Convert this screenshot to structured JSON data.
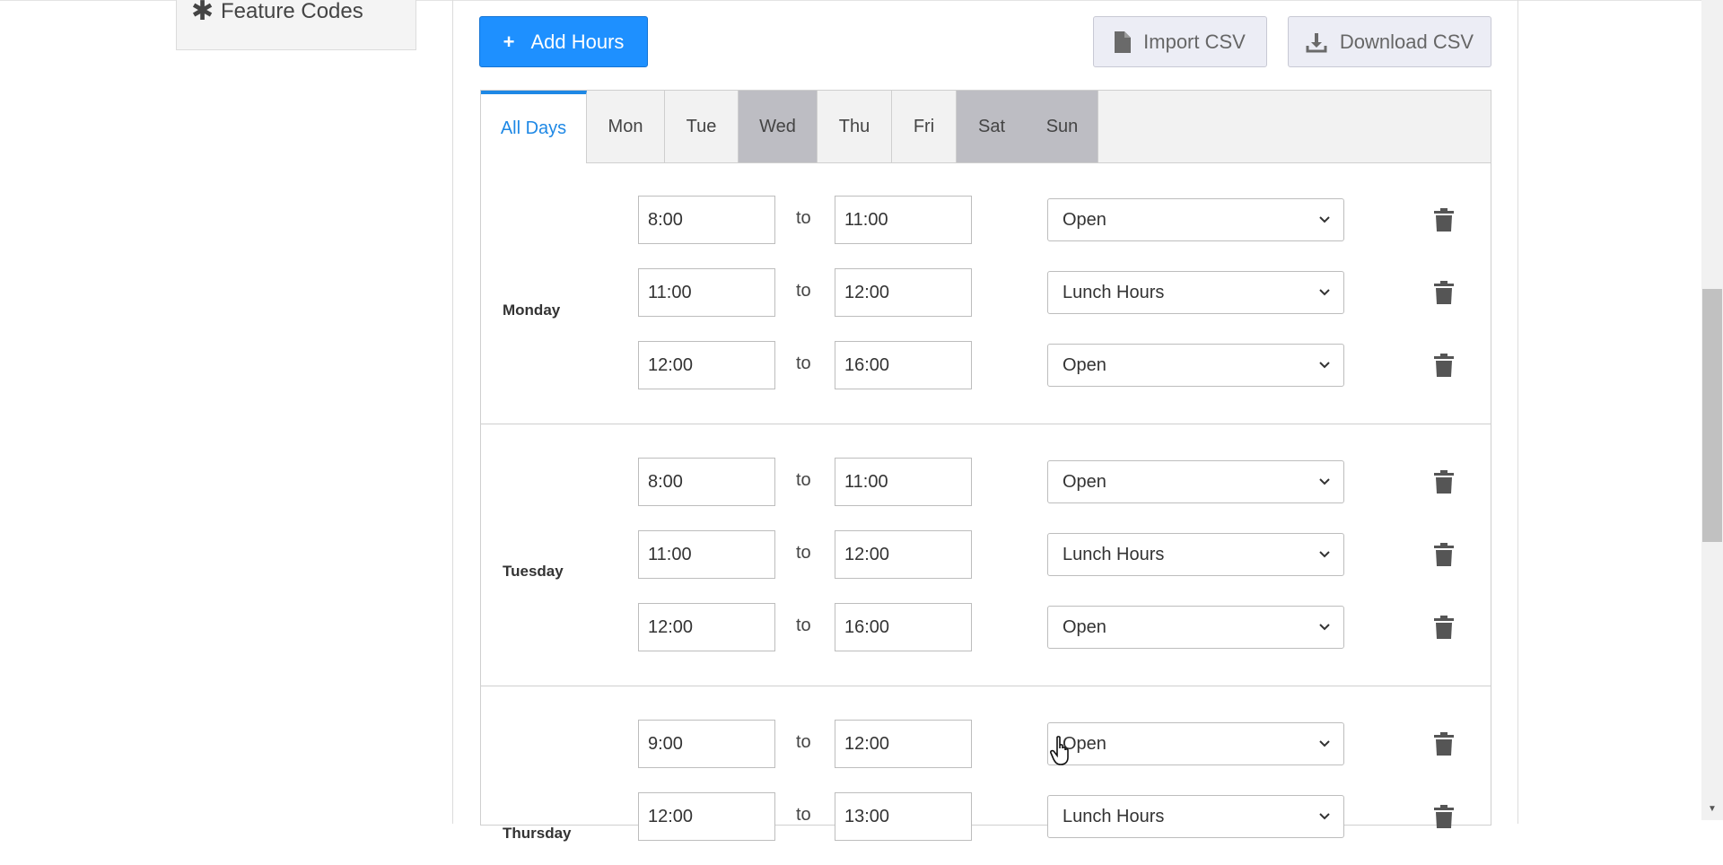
{
  "sidebar": {
    "feature_codes_label": "Feature Codes"
  },
  "toolbar": {
    "add_hours_label": "Add Hours",
    "import_csv_label": "Import CSV",
    "download_csv_label": "Download CSV"
  },
  "tabs": [
    "All Days",
    "Mon",
    "Tue",
    "Wed",
    "Thu",
    "Fri",
    "Sat",
    "Sun"
  ],
  "active_tab": "All Days",
  "days": [
    {
      "name": "Monday",
      "rows": [
        {
          "from": "8:00",
          "to": "11:00",
          "type": "Open"
        },
        {
          "from": "11:00",
          "to": "12:00",
          "type": "Lunch Hours"
        },
        {
          "from": "12:00",
          "to": "16:00",
          "type": "Open"
        }
      ]
    },
    {
      "name": "Tuesday",
      "rows": [
        {
          "from": "8:00",
          "to": "11:00",
          "type": "Open"
        },
        {
          "from": "11:00",
          "to": "12:00",
          "type": "Lunch Hours"
        },
        {
          "from": "12:00",
          "to": "16:00",
          "type": "Open"
        }
      ]
    },
    {
      "name": "Thursday",
      "rows": [
        {
          "from": "9:00",
          "to": "12:00",
          "type": "Open"
        },
        {
          "from": "12:00",
          "to": "13:00",
          "type": "Lunch Hours"
        }
      ]
    }
  ],
  "to_label": "to",
  "colors": {
    "primary": "#1e90ff",
    "active_tab": "#1e88e5",
    "dark_tab": "#bdbdc3"
  }
}
